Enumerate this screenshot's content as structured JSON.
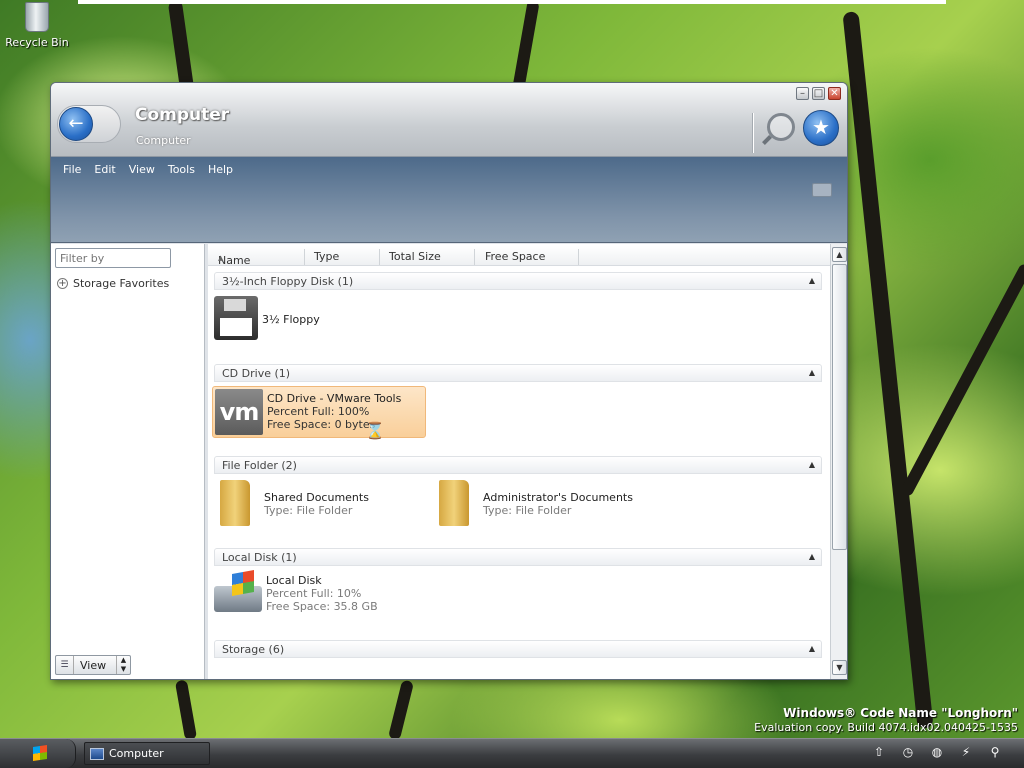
{
  "desktop": {
    "recycle_bin_label": "Recycle Bin",
    "watermark_line1": "Windows® Code Name \"Longhorn\"",
    "watermark_line2": "Evaluation copy. Build 4074.idx02.040425-1535"
  },
  "window": {
    "title": "Computer",
    "subtitle": "Computer",
    "controls": {
      "minimize": "–",
      "maximize": "□",
      "close": "✕"
    },
    "menu": [
      "File",
      "Edit",
      "View",
      "Tools",
      "Help"
    ]
  },
  "left_pane": {
    "filter_placeholder": "Filter by",
    "storage_favorites": "Storage Favorites",
    "view_button": "View"
  },
  "columns": [
    "Name",
    "Type",
    "Total Size",
    "Free Space"
  ],
  "groups": [
    {
      "header": "3½-Inch Floppy Disk (1)",
      "items": [
        {
          "name": "3½ Floppy",
          "icon": "floppy-icon"
        }
      ]
    },
    {
      "header": "CD Drive (1)",
      "items": [
        {
          "name": "CD Drive - VMware Tools",
          "line2": "Percent Full: 100%",
          "line3": "Free Space: 0 bytes",
          "icon": "vmware-cd-icon",
          "selected": true
        }
      ]
    },
    {
      "header": "File Folder (2)",
      "items": [
        {
          "name": "Shared Documents",
          "line2": "Type: File Folder",
          "icon": "folder-icon"
        },
        {
          "name": "Administrator's Documents",
          "line2": "Type: File Folder",
          "icon": "folder-icon"
        }
      ]
    },
    {
      "header": "Local Disk (1)",
      "items": [
        {
          "name": "Local Disk",
          "line2": "Percent Full: 10%",
          "line3": "Free Space: 35.8 GB",
          "icon": "local-disk-icon"
        }
      ]
    },
    {
      "header": "Storage (6)",
      "items": []
    }
  ],
  "taskbar": {
    "task_label": "Computer"
  }
}
